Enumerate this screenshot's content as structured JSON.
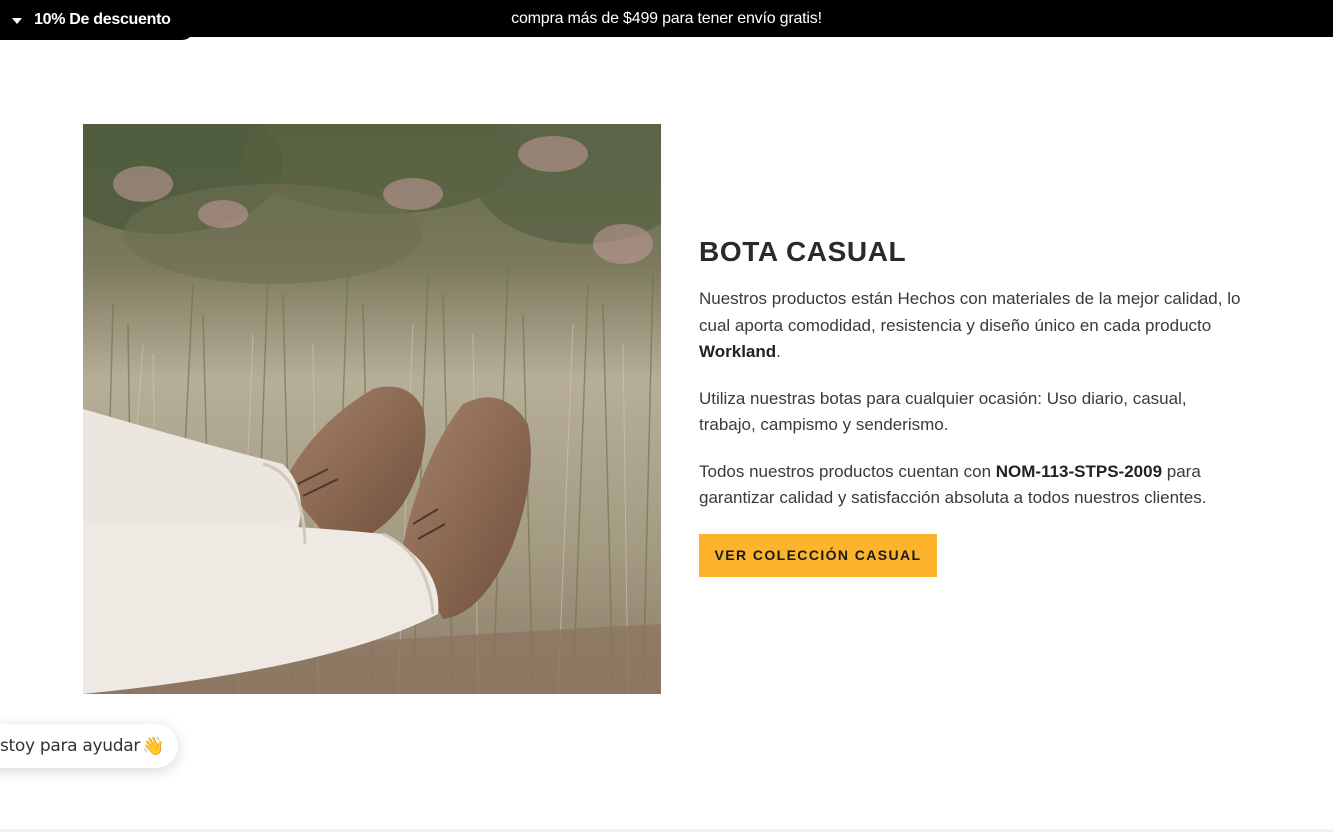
{
  "announcement": {
    "discount_label": "10% De descuento",
    "shipping_text": "compra más de $499 para tener envío gratis!"
  },
  "feature": {
    "image_alt": "Botas casuales café sobre pasto",
    "heading": "BOTA CASUAL",
    "paragraph1_text": "Nuestros productos están Hechos con materiales de la mejor calidad, lo cual aporta comodidad, resistencia y diseño único en cada producto ",
    "paragraph1_bold": "Workland",
    "paragraph1_end": ".",
    "paragraph2": "Utiliza nuestras botas para cualquier ocasión: Uso diario, casual, trabajo, campismo y senderismo.",
    "paragraph3_start": "Todos nuestros productos cuentan con ",
    "paragraph3_bold": "NOM-113-STPS-2009",
    "paragraph3_end": " para garantizar calidad y satisfacción absoluta a todos nuestros clientes.",
    "cta_label": "VER COLECCIÓN CASUAL"
  },
  "chat": {
    "bubble_text": "stoy para ayudar",
    "bubble_emoji": "👋"
  },
  "colors": {
    "announcement_bg": "#000000",
    "cta_bg": "#fbb42c",
    "text": "#3a3a3a"
  }
}
